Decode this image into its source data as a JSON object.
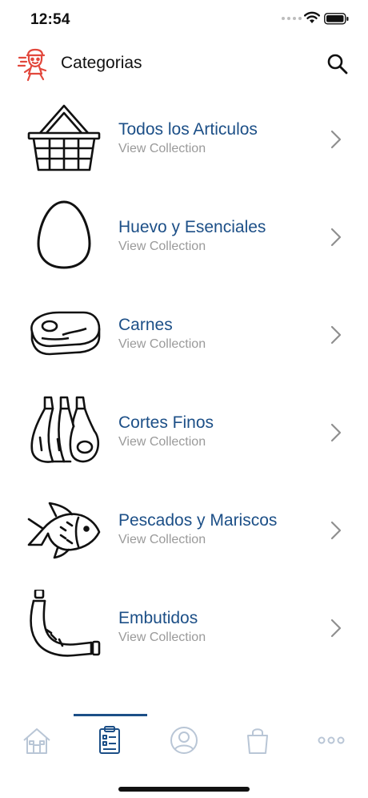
{
  "status_bar": {
    "time": "12:54"
  },
  "header": {
    "title": "Categorias"
  },
  "categories": [
    {
      "title": "Todos los Articulos",
      "subtitle": "View Collection",
      "icon": "basket-icon"
    },
    {
      "title": "Huevo y Esenciales",
      "subtitle": "View Collection",
      "icon": "egg-icon"
    },
    {
      "title": "Carnes",
      "subtitle": "View Collection",
      "icon": "steak-icon"
    },
    {
      "title": "Cortes Finos",
      "subtitle": "View Collection",
      "icon": "rack-of-ribs-icon"
    },
    {
      "title": "Pescados y Mariscos",
      "subtitle": "View Collection",
      "icon": "fish-icon"
    },
    {
      "title": "Embutidos",
      "subtitle": "View Collection",
      "icon": "sausage-icon"
    }
  ],
  "tabs": [
    {
      "name": "home",
      "icon": "home-icon",
      "active": false
    },
    {
      "name": "categories",
      "icon": "clipboard-list-icon",
      "active": true
    },
    {
      "name": "account",
      "icon": "user-icon",
      "active": false
    },
    {
      "name": "cart",
      "icon": "shopping-bag-icon",
      "active": false
    },
    {
      "name": "more",
      "icon": "more-dots-icon",
      "active": false
    }
  ],
  "colors": {
    "accent": "#1c4f87",
    "subtitle": "#9a9a9a",
    "logo": "#e2483d",
    "tab_inactive": "#b9c6d6"
  }
}
